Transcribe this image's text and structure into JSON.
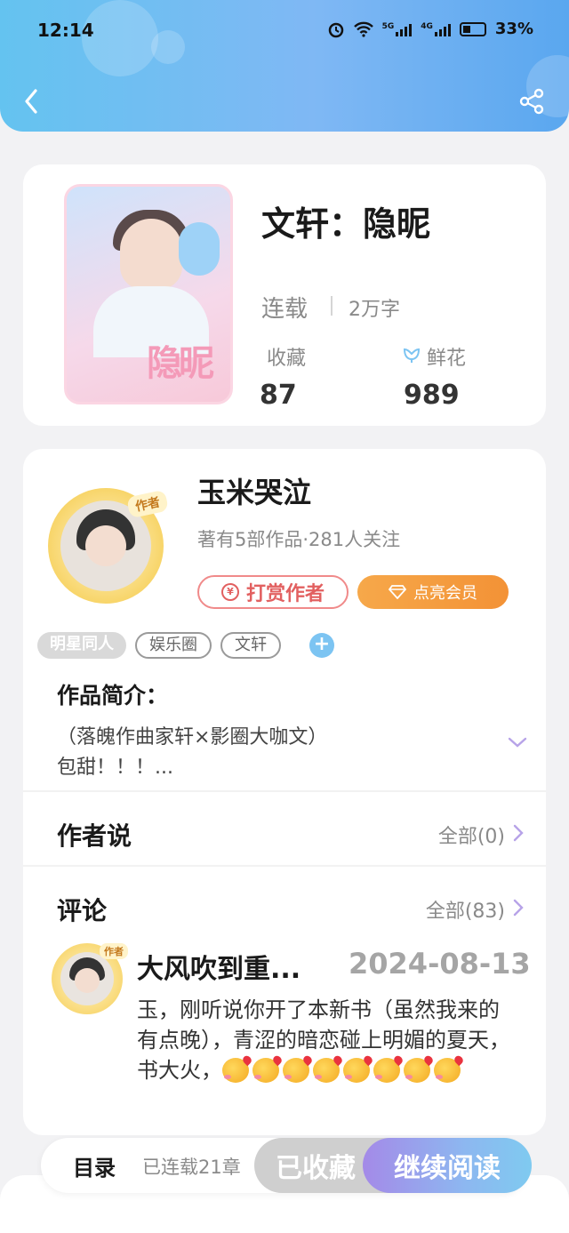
{
  "status_bar": {
    "time": "12:14",
    "net1": "5G",
    "net2": "4G",
    "battery": "33%"
  },
  "book": {
    "title": "文轩：隐昵",
    "status": "连载",
    "words": "2万字",
    "favorites_label": "收藏",
    "favorites_value": "87",
    "flowers_label": "鲜花",
    "flowers_value": "989",
    "cover_text": "隐昵"
  },
  "author": {
    "badge": "作者",
    "name": "玉米哭泣",
    "stats": "著有5部作品·281人关注",
    "tip_label": "打赏作者",
    "tip_coin": "¥",
    "vip_label": "点亮会员"
  },
  "tags": [
    "明星同人",
    "娱乐圈",
    "文轩"
  ],
  "tag_add": "+",
  "intro": {
    "title": "作品简介：",
    "line1": "（落魄作曲家轩×影圈大咖文）",
    "line2": "包甜！！！..."
  },
  "author_says": {
    "title": "作者说",
    "more": "全部(0)"
  },
  "comments": {
    "title": "评论",
    "more": "全部(83)",
    "item": {
      "badge": "作者",
      "name": "大风吹到重...",
      "date": "2024-08-13",
      "text": "玉，刚听说你开了本新书（虽然我来的有点晚），青涩的暗恋碰上明媚的夏天，书大火，"
    }
  },
  "bottom_bar": {
    "catalog_label": "目录",
    "catalog_status": "已连载21章",
    "collected_label": "已收藏",
    "continue_label": "继续阅读"
  },
  "colors": {
    "header": "#64c3f0",
    "tip": "#e26060",
    "vip": "#f39236",
    "tag_add": "#7cc4f2"
  }
}
